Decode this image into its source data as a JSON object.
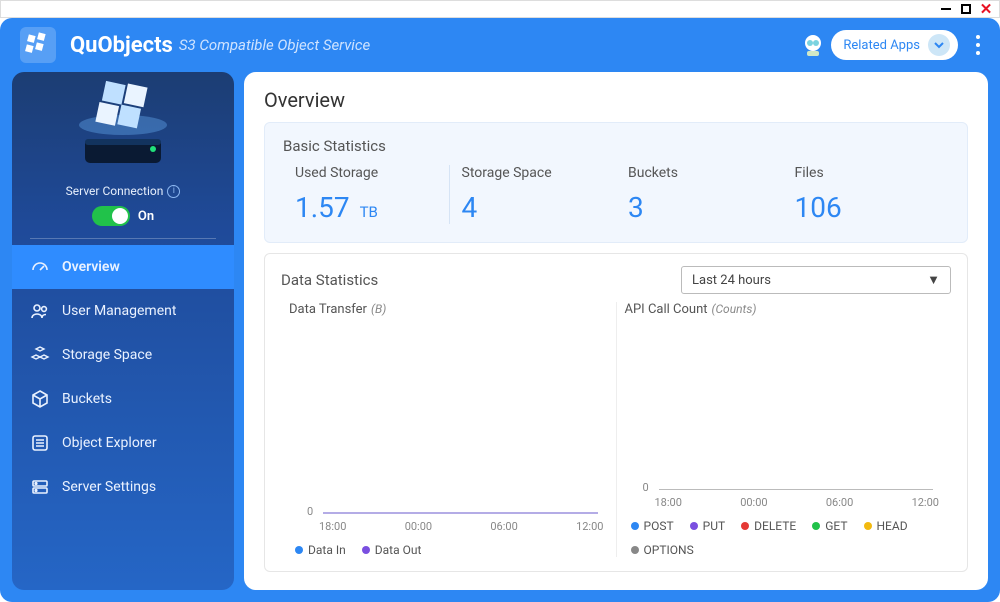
{
  "app": {
    "name": "QuObjects",
    "subtitle": "S3 Compatible Object Service"
  },
  "header": {
    "related_apps": "Related Apps"
  },
  "server": {
    "connection_label": "Server Connection",
    "toggle_state": "On"
  },
  "nav": {
    "overview": "Overview",
    "user_mgmt": "User Management",
    "storage_space": "Storage Space",
    "buckets": "Buckets",
    "object_explorer": "Object Explorer",
    "server_settings": "Server Settings",
    "active": "overview"
  },
  "page": {
    "title": "Overview"
  },
  "basic": {
    "card_title": "Basic Statistics",
    "used_storage_label": "Used Storage",
    "used_storage_value": "1.57",
    "used_storage_unit": "TB",
    "storage_space_label": "Storage Space",
    "storage_space_value": "4",
    "buckets_label": "Buckets",
    "buckets_value": "3",
    "files_label": "Files",
    "files_value": "106"
  },
  "data": {
    "card_title": "Data Statistics",
    "range_selected": "Last 24 hours",
    "transfer": {
      "title": "Data Transfer",
      "unit": "(B)",
      "xticks": [
        "18:00",
        "00:00",
        "06:00",
        "12:00"
      ],
      "legend": [
        {
          "name": "Data In",
          "color": "#2d87f3"
        },
        {
          "name": "Data Out",
          "color": "#7a4fe0"
        }
      ]
    },
    "api": {
      "title": "API Call Count",
      "unit": "(Counts)",
      "xticks": [
        "18:00",
        "00:00",
        "06:00",
        "12:00"
      ],
      "legend": [
        {
          "name": "POST",
          "color": "#2d87f3"
        },
        {
          "name": "PUT",
          "color": "#7a4fe0"
        },
        {
          "name": "DELETE",
          "color": "#e53935"
        },
        {
          "name": "GET",
          "color": "#21c24a"
        },
        {
          "name": "HEAD",
          "color": "#f2b90f"
        },
        {
          "name": "OPTIONS",
          "color": "#888"
        }
      ]
    }
  },
  "chart_data": [
    {
      "type": "line",
      "title": "Data Transfer (B)",
      "x": [
        "18:00",
        "00:00",
        "06:00",
        "12:00"
      ],
      "series": [
        {
          "name": "Data In",
          "values": [
            0,
            0,
            0,
            0
          ]
        },
        {
          "name": "Data Out",
          "values": [
            0,
            0,
            0,
            0
          ]
        }
      ],
      "ylim": [
        0,
        1
      ],
      "xlabel": "",
      "ylabel": ""
    },
    {
      "type": "line",
      "title": "API Call Count (Counts)",
      "x": [
        "18:00",
        "00:00",
        "06:00",
        "12:00"
      ],
      "series": [
        {
          "name": "POST",
          "values": [
            0,
            0,
            0,
            0
          ]
        },
        {
          "name": "PUT",
          "values": [
            0,
            0,
            0,
            0
          ]
        },
        {
          "name": "DELETE",
          "values": [
            0,
            0,
            0,
            0
          ]
        },
        {
          "name": "GET",
          "values": [
            0,
            0,
            0,
            0
          ]
        },
        {
          "name": "HEAD",
          "values": [
            0,
            0,
            0,
            0
          ]
        },
        {
          "name": "OPTIONS",
          "values": [
            0,
            0,
            0,
            0
          ]
        }
      ],
      "ylim": [
        0,
        1
      ],
      "xlabel": "",
      "ylabel": ""
    }
  ]
}
